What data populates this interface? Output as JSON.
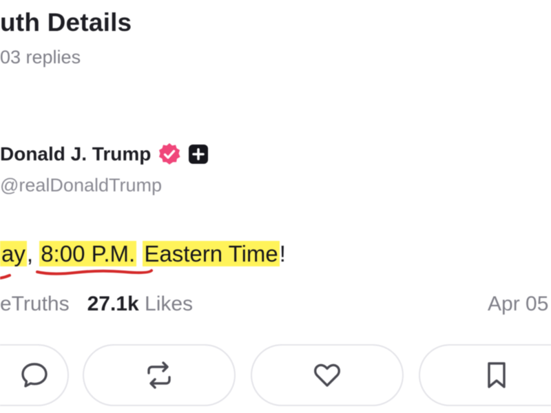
{
  "header": {
    "title": "uth Details",
    "replies": "03 replies"
  },
  "author": {
    "name": "Donald J. Trump",
    "handle": "@realDonaldTrump",
    "verified_color": "#f0467a"
  },
  "post": {
    "text_prefix": "ay",
    "text_sep": ", ",
    "time": "8:00 P.M.",
    "text_space": " ",
    "zone": "Eastern Time",
    "text_end": "!"
  },
  "stats": {
    "retruths_label": "eTruths",
    "likes_count": "27.1k",
    "likes_label": "Likes",
    "date": "Apr 05"
  },
  "actions": {
    "reply_icon": "reply-icon",
    "retruth_icon": "retruth-icon",
    "like_icon": "heart-icon",
    "bookmark_icon": "bookmark-icon"
  },
  "colors": {
    "highlight": "#fff35a",
    "annotation": "#d42a2a",
    "text": "#1e1e24",
    "muted": "#808089"
  }
}
